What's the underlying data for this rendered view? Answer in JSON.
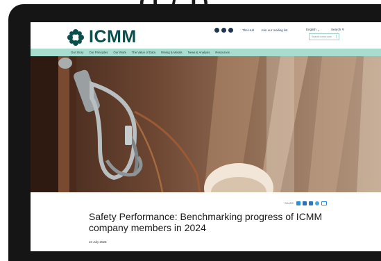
{
  "caption": "(1 / 1)",
  "header": {
    "logo_text": "ICMM",
    "util_links": [
      "The Hub",
      "Join our mailing list"
    ],
    "language": "English",
    "search_label": "Search",
    "search_placeholder": "Search icmm.com"
  },
  "nav": {
    "items": [
      "Our Story",
      "Our Principles",
      "Our Work",
      "The Value of Data",
      "Mining & Metals",
      "News & Analysis",
      "Resources"
    ]
  },
  "article": {
    "share_label": "SHARE",
    "title": "Safety Performance: Benchmarking progress of ICMM company members in 2024",
    "date": "10 July 2025"
  },
  "colors": {
    "brand": "#0b4e4c",
    "nav_bg": "#a8dccf",
    "share_icons": "#2a8fd6"
  },
  "icons": [
    "icmm-logo-icon",
    "linkedin-icon",
    "twitter-icon",
    "youtube-icon",
    "chevron-down-icon",
    "search-icon",
    "whatsapp-icon",
    "email-icon",
    "facebook-icon"
  ]
}
